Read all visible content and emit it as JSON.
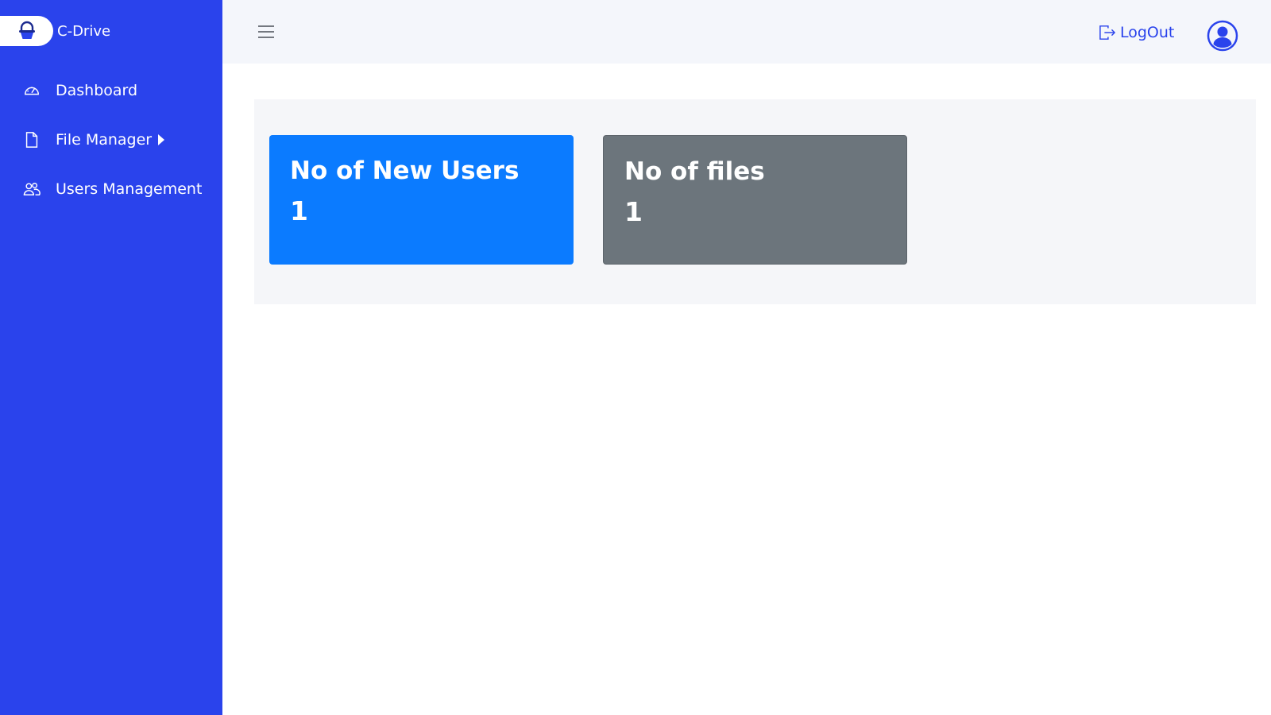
{
  "app": {
    "name": "C-Drive"
  },
  "sidebar": {
    "items": [
      {
        "label": "Dashboard",
        "icon": "speedometer-icon"
      },
      {
        "label": "File Manager",
        "icon": "file-icon",
        "has_submenu": true
      },
      {
        "label": "Users Management",
        "icon": "users-icon"
      }
    ]
  },
  "topbar": {
    "logout_label": "LogOut",
    "icons": {
      "menu": "hamburger-icon",
      "logout": "logout-icon",
      "profile": "user-circle-icon"
    }
  },
  "stats": {
    "new_users": {
      "label": "No of New Users",
      "value": "1"
    },
    "files": {
      "label": "No of files",
      "value": "1"
    }
  },
  "colors": {
    "sidebar": "#2a43ec",
    "topbar": "#f4f6fb",
    "card_users": "#0b7bff",
    "card_files": "#6c757c",
    "accent_text": "#2a43ec"
  }
}
